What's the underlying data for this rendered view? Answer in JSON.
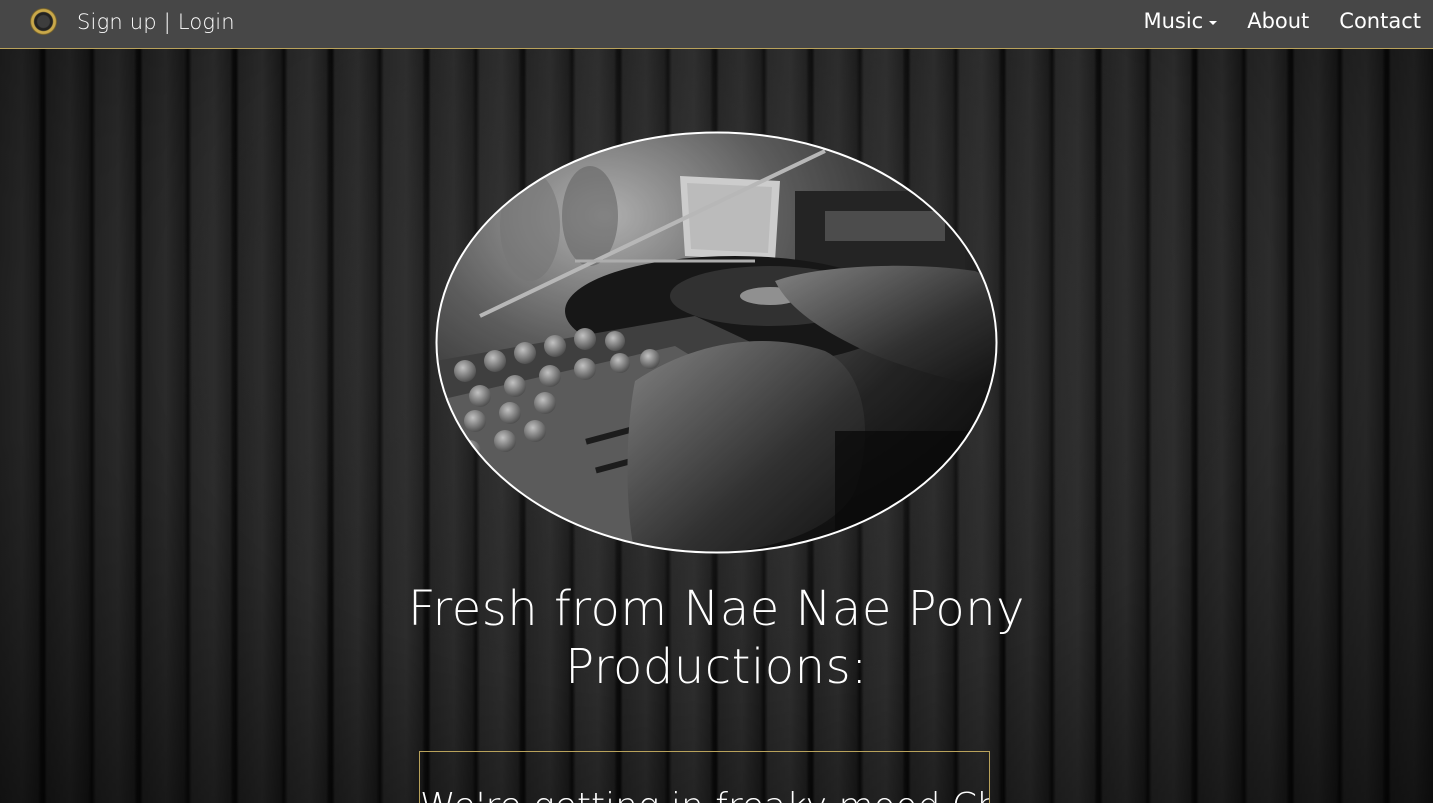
{
  "navbar": {
    "logo_icon": "vinyl-record-icon",
    "login_label": "Sign up | Login",
    "links": [
      {
        "label": "Music",
        "has_dropdown": true
      },
      {
        "label": "About"
      },
      {
        "label": "Contact"
      }
    ]
  },
  "hero": {
    "image_alt": "DJ mixing at turntable and mixer (black and white photo)"
  },
  "headline": "Fresh from Nae Nae Pony Productions:",
  "featured": {
    "text": "We're getting in freaky mood Check"
  },
  "colors": {
    "navbar_bg": "#474747",
    "accent_gold": "#b9a25b",
    "text": "#ffffff",
    "background": "#1c1c1c"
  }
}
